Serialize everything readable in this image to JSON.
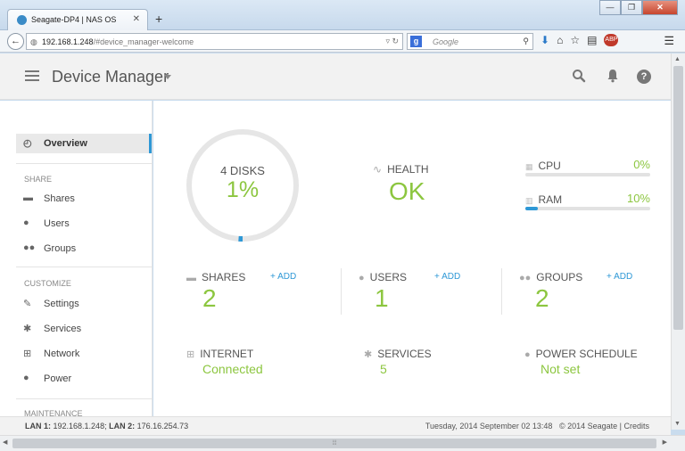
{
  "browser": {
    "tab_title": "Seagate-DP4 | NAS OS",
    "tab_close": "✕",
    "new_tab": "+",
    "url_host": "192.168.1.248",
    "url_path": "/#device_manager-welcome",
    "search_engine": "Google",
    "search_placeholder": "Google",
    "addon_badge": "ABP"
  },
  "header": {
    "title": "Device Manager"
  },
  "sidebar": {
    "overview": "Overview",
    "share_section": "SHARE",
    "shares": "Shares",
    "users": "Users",
    "groups": "Groups",
    "customize_section": "CUSTOMIZE",
    "settings": "Settings",
    "services": "Services",
    "network": "Network",
    "power": "Power",
    "maintenance_section": "MAINTENANCE"
  },
  "dashboard": {
    "disks_label": "4 DISKS",
    "disks_usage": "1%",
    "disks_usage_fraction": 0.01,
    "health_label": "HEALTH",
    "health_value": "OK",
    "cpu_label": "CPU",
    "cpu_value": "0%",
    "cpu_fraction": 0.0,
    "ram_label": "RAM",
    "ram_value": "10%",
    "ram_fraction": 0.1,
    "shares_label": "SHARES",
    "shares_count": "2",
    "users_label": "USERS",
    "users_count": "1",
    "groups_label": "GROUPS",
    "groups_count": "2",
    "add_label": "+ ADD",
    "internet_label": "INTERNET",
    "internet_value": "Connected",
    "services_label": "SERVICES",
    "services_value": "5",
    "power_label": "POWER SCHEDULE",
    "power_value": "Not set"
  },
  "footer": {
    "lan1_label": "LAN 1:",
    "lan1_ip": "192.168.1.248;",
    "lan2_label": "LAN 2:",
    "lan2_ip": "176.16.254.73",
    "datetime": "Tuesday, 2014 September 02   13:48",
    "copyright": "© 2014 Seagate | Credits"
  },
  "colors": {
    "accent_green": "#8cc63f",
    "accent_blue": "#2e98d6"
  }
}
